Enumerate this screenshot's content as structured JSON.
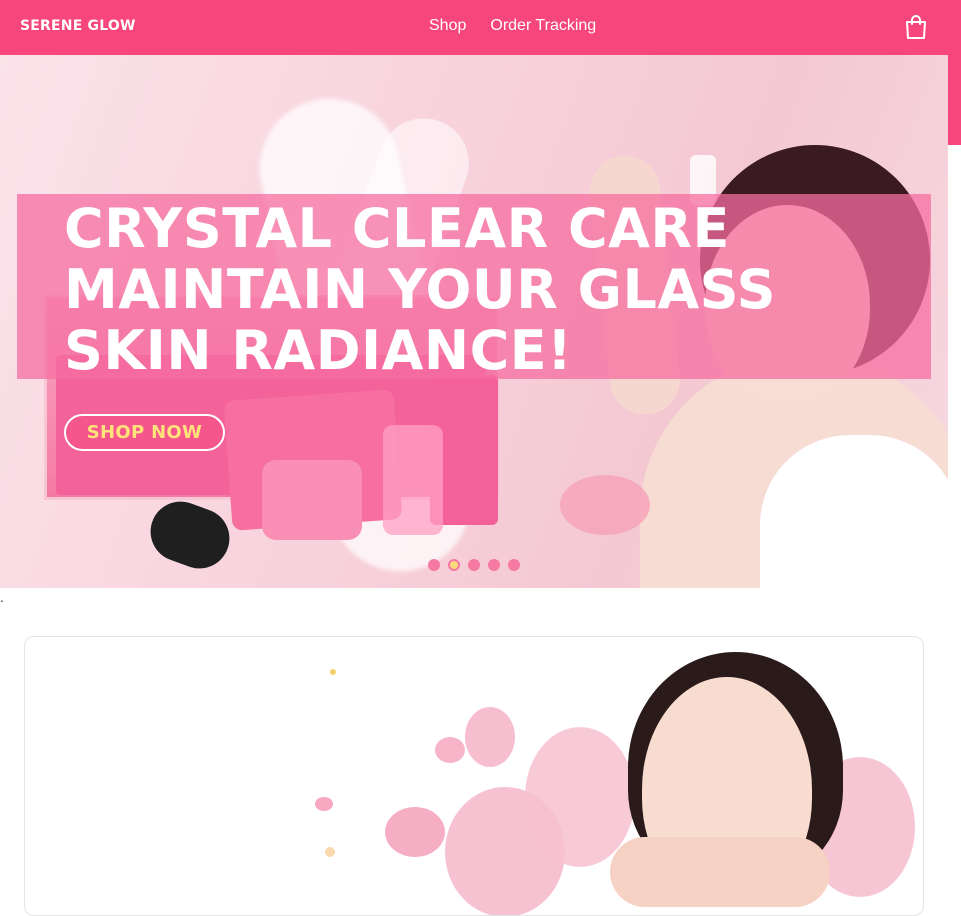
{
  "brand": {
    "name": "SERENE GLOW"
  },
  "nav": {
    "links": [
      "Shop",
      "Order Tracking"
    ],
    "cart_icon": "shopping-bag-icon"
  },
  "hero": {
    "headline": "CRYSTAL CLEAR CARE\nMAINTAIN YOUR GLASS\nSKIN RADIANCE!",
    "cta_label": "SHOP NOW",
    "carousel": {
      "slide_count": 5,
      "active_index": 1
    }
  },
  "misc": {
    "stray_text": "."
  },
  "colors": {
    "brand_pink": "#f7467c",
    "banner_overlay": "#f56ea0",
    "cta_text": "#ffe27a",
    "dot_active": "#f9d97a"
  }
}
